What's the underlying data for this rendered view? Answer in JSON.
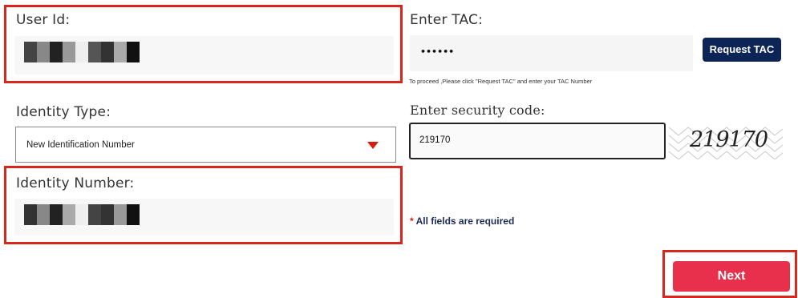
{
  "user_id": {
    "label": "User Id:",
    "value_masked": true
  },
  "identity_type": {
    "label": "Identity Type:",
    "selected": "New Identification Number"
  },
  "identity_number": {
    "label": "Identity Number:",
    "value_masked": true
  },
  "tac": {
    "label": "Enter TAC:",
    "value": "••••••",
    "button_label": "Request TAC",
    "hint": "To proceed ,Please click \"Request TAC\" and enter your TAC Number"
  },
  "security": {
    "label": "Enter security code:",
    "value": "219170",
    "captcha_text": "219170"
  },
  "required": {
    "asterisk": "*",
    "text": "All fields are required"
  },
  "next_label": "Next",
  "colors": {
    "highlight": "#d8261c",
    "primary_button": "#0d2456",
    "next_button": "#e8304c",
    "arrow": "#d71d10"
  },
  "icons": {
    "select_arrow": "triangle-down-icon"
  }
}
